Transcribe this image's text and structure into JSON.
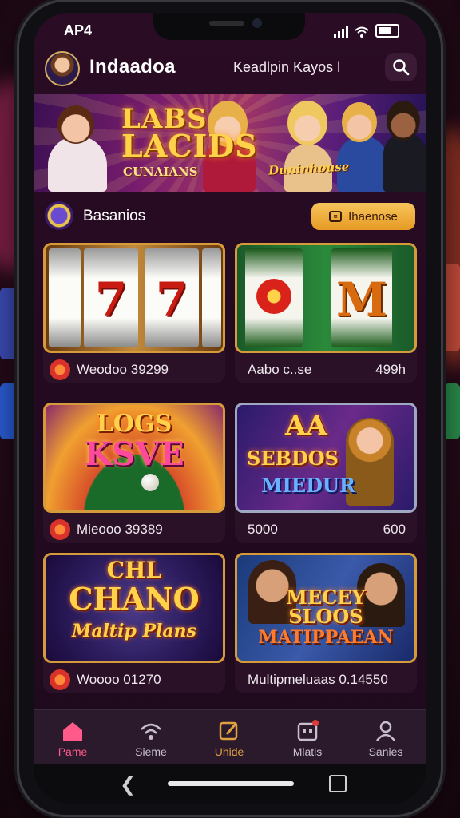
{
  "status_bar": {
    "time": "AP4"
  },
  "header": {
    "app_title": "Indaadoa",
    "subtitle": "Keadlpin Kayos  l",
    "search_icon": "search-icon"
  },
  "banner": {
    "title_line1": "LABS",
    "title_line2": "LACIDS",
    "subtitle": "CUNAIANS",
    "badge": "Duninhouse"
  },
  "section": {
    "title": "Basanios",
    "button_label": "Ihaenose"
  },
  "games": [
    {
      "art_title": "",
      "name": "Weodoo 39299",
      "value": "",
      "has_icon": true
    },
    {
      "art_title": "",
      "name": "Aabo c..se",
      "value": "499h",
      "has_icon": false
    },
    {
      "art_title_l1": "LOGS",
      "art_title_l2": "KSVE",
      "name": "Mieooo 39389",
      "value": "",
      "has_icon": true
    },
    {
      "art_title_l1": "AA",
      "art_title_l2": "SEBDOS",
      "art_title_l3": "MIEDUR",
      "name": "5000",
      "value": "600",
      "has_icon": false
    },
    {
      "art_title_l1": "CHL",
      "art_title_l2": "CHANO",
      "art_title_l3": "Maltip Plans",
      "name": "Woooo 01270",
      "value": "",
      "has_icon": true
    },
    {
      "art_title_l1": "MECEY",
      "art_title_l2": "SLOOS",
      "art_title_l3": "MATIPPAEAN",
      "name": "Multipmeluaas 0.14550",
      "value": "",
      "has_icon": false
    }
  ],
  "slot_symbols": {
    "card1_left": "7",
    "card1_right": "7",
    "card2_right": "M"
  },
  "tabs": [
    {
      "label": "Pame",
      "icon": "home-icon",
      "active": true
    },
    {
      "label": "Sieme",
      "icon": "signal-icon",
      "active": false
    },
    {
      "label": "Uhide",
      "icon": "edit-icon",
      "active": false
    },
    {
      "label": "Mlatis",
      "icon": "calendar-icon",
      "active": false
    },
    {
      "label": "Sanies",
      "icon": "user-icon",
      "active": false
    }
  ],
  "colors": {
    "accent": "#f7c55b",
    "active_tab": "#ff5a8a",
    "background": "#240a21"
  }
}
